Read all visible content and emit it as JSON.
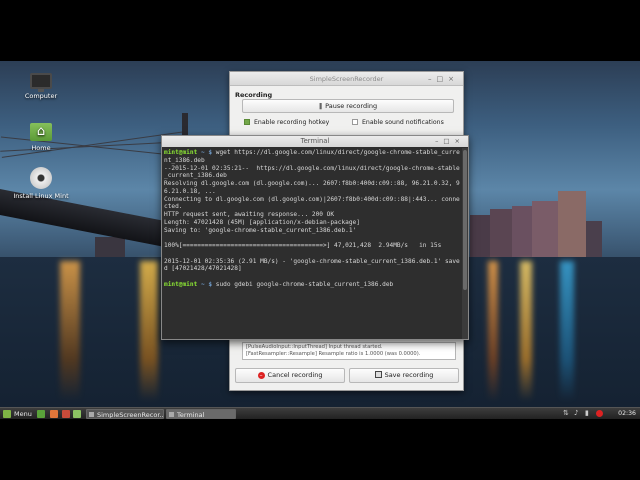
{
  "desktop": {
    "icons": [
      {
        "label": "Computer",
        "icon": "computer-icon"
      },
      {
        "label": "Home",
        "icon": "home-folder-icon"
      },
      {
        "label": "Install Linux Mint",
        "icon": "disc-icon"
      }
    ]
  },
  "recorder": {
    "title": "SimpleScreenRecorder",
    "section": "Recording",
    "pause_label": "Pause recording",
    "hotkey_label": "Enable recording hotkey",
    "hotkey_checked": true,
    "sound_label": "Enable sound notifications",
    "sound_checked": false,
    "log_lines": [
      "[PulseAudioInput::InputThread] Input thread started.",
      "[FastResampler::Resample] Resample ratio is 1.0000 (was 0.0000)."
    ],
    "cancel_label": "Cancel recording",
    "save_label": "Save recording"
  },
  "terminal": {
    "title": "Terminal",
    "prompt_host": "mint@mint",
    "prompt_path": "~ $",
    "lines": [
      {
        "type": "prompt",
        "cmd": "wget https://dl.google.com/linux/direct/google-chrome-stable_curre"
      },
      {
        "type": "out",
        "text": "nt_i386.deb"
      },
      {
        "type": "out",
        "text": "--2015-12-01 02:35:21--  https://dl.google.com/linux/direct/google-chrome-stable"
      },
      {
        "type": "out",
        "text": "_current_i386.deb"
      },
      {
        "type": "out",
        "text": "Resolving dl.google.com (dl.google.com)... 2607:f8b0:400d:c09::88, 96.21.0.32, 9"
      },
      {
        "type": "out",
        "text": "6.21.0.18, ..."
      },
      {
        "type": "out",
        "text": "Connecting to dl.google.com (dl.google.com)|2607:f8b0:400d:c09::88|:443... conne"
      },
      {
        "type": "out",
        "text": "cted."
      },
      {
        "type": "out",
        "text": "HTTP request sent, awaiting response... 200 OK"
      },
      {
        "type": "out",
        "text": "Length: 47021428 (45M) [application/x-debian-package]"
      },
      {
        "type": "out",
        "text": "Saving to: 'google-chrome-stable_current_i386.deb.1'"
      },
      {
        "type": "out",
        "text": ""
      },
      {
        "type": "out",
        "text": "100%[======================================>] 47,021,428  2.94MB/s   in 15s"
      },
      {
        "type": "out",
        "text": ""
      },
      {
        "type": "out",
        "text": "2015-12-01 02:35:36 (2.91 MB/s) - 'google-chrome-stable_current_i386.deb.1' save"
      },
      {
        "type": "out",
        "text": "d [47021428/47021428]"
      },
      {
        "type": "out",
        "text": ""
      },
      {
        "type": "prompt",
        "cmd": "sudo gdebi google-chrome-stable_current_i386.deb"
      }
    ]
  },
  "taskbar": {
    "menu_label": "Menu",
    "tasks": [
      {
        "label": "SimpleScreenRecor...",
        "active": false
      },
      {
        "label": "Terminal",
        "active": true
      }
    ],
    "clock": "02:36"
  }
}
